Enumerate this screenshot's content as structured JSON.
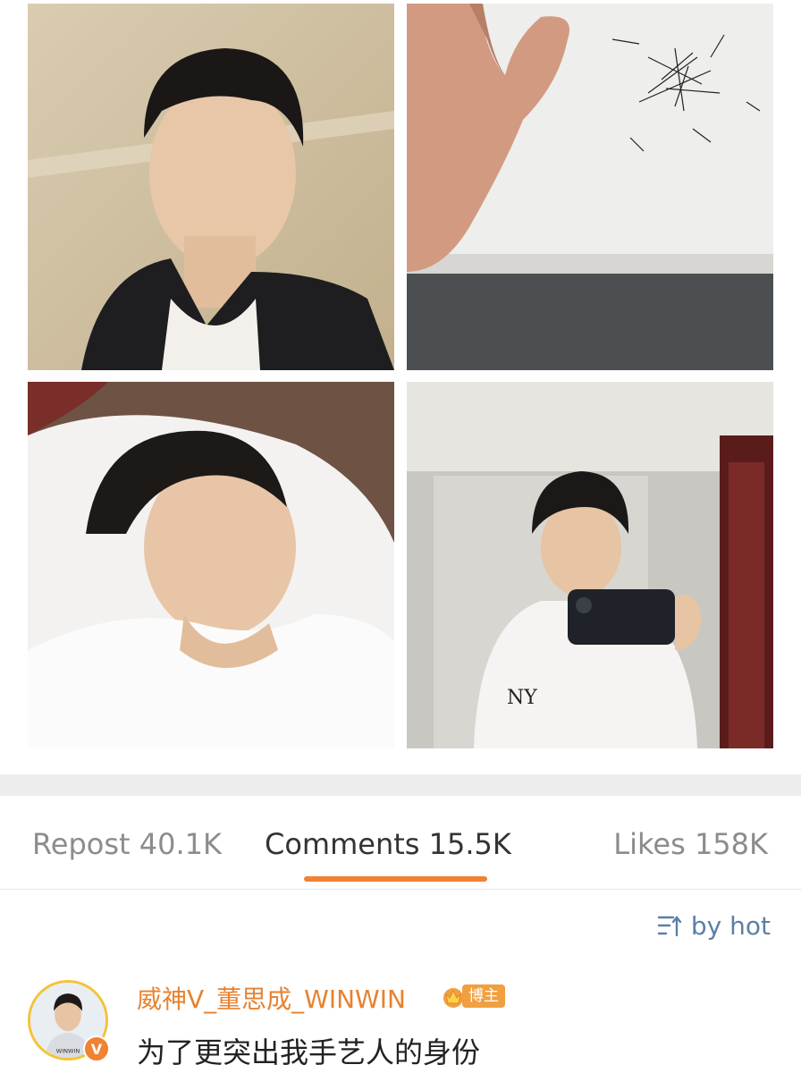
{
  "tabs": {
    "repost": "Repost 40.1K",
    "comments": "Comments 15.5K",
    "likes": "Likes 158K",
    "active_color": "#f08232"
  },
  "sort": {
    "label": "by hot",
    "icon": "sort-lines-icon"
  },
  "comment": {
    "username": "威神V_董思成_WINWIN",
    "badge": "博主",
    "badge_icon": "crown-icon",
    "verified": "V",
    "avatar_caption": "WINWIN",
    "text": "为了更突出我手艺人的身份"
  },
  "colors": {
    "accent_orange": "#f08232",
    "username": "#e7822f",
    "link_blue": "#5b7fa8",
    "muted": "#8c8c8c"
  }
}
